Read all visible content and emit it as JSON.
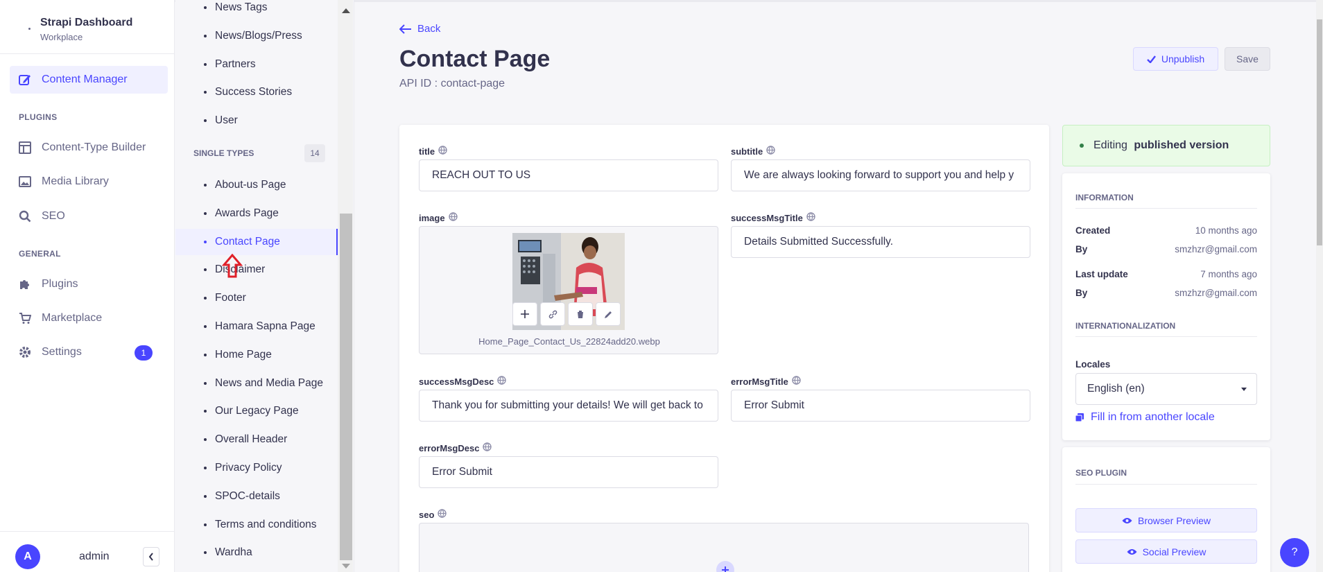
{
  "brand": {
    "title": "Strapi Dashboard",
    "subtitle": "Workplace"
  },
  "mainnav": {
    "content_manager": "Content Manager",
    "plugins_section": "PLUGINS",
    "content_type_builder": "Content-Type Builder",
    "media_library": "Media Library",
    "seo": "SEO",
    "general_section": "GENERAL",
    "plugins": "Plugins",
    "marketplace": "Marketplace",
    "settings": "Settings",
    "settings_badge": "1",
    "user_initial": "A",
    "user_name": "admin"
  },
  "subnav": {
    "collection_items": [
      "News Tags",
      "News/Blogs/Press",
      "Partners",
      "Success Stories",
      "User"
    ],
    "single_types_label": "SINGLE TYPES",
    "single_types_count": "14",
    "single_items": [
      "About-us Page",
      "Awards Page",
      "Contact Page",
      "Disclaimer",
      "Footer",
      "Hamara Sapna Page",
      "Home Page",
      "News and Media Page",
      "Our Legacy Page",
      "Overall Header",
      "Privacy Policy",
      "SPOC-details",
      "Terms and conditions",
      "Wardha"
    ]
  },
  "header": {
    "back": "Back",
    "title": "Contact Page",
    "api_id": "API ID : contact-page",
    "unpublish": "Unpublish",
    "save": "Save"
  },
  "form": {
    "title_label": "title",
    "title_value": "REACH OUT TO US",
    "subtitle_label": "subtitle",
    "subtitle_value": "We are always looking forward to support you and help y",
    "image_label": "image",
    "image_name": "Home_Page_Contact_Us_22824add20.webp",
    "success_title_label": "successMsgTitle",
    "success_title_value": "Details Submitted Successfully.",
    "success_desc_label": "successMsgDesc",
    "success_desc_value": "Thank you for submitting your details! We will get back to",
    "error_title_label": "errorMsgTitle",
    "error_title_value": "Error Submit",
    "error_desc_label": "errorMsgDesc",
    "error_desc_value": "Error Submit",
    "seo_label": "seo"
  },
  "sidebar": {
    "status_prefix": "Editing ",
    "status_strong": "published version",
    "information": "INFORMATION",
    "created_label": "Created",
    "created_value": "10 months ago",
    "by_label": "By",
    "created_by": "smzhzr@gmail.com",
    "last_update_label": "Last update",
    "last_update_value": "7 months ago",
    "updated_by": "smzhzr@gmail.com",
    "i18n": "INTERNATIONALIZATION",
    "locales_label": "Locales",
    "locale_value": "English (en)",
    "fill_locale": "Fill in from another locale",
    "seo_plugin": "SEO PLUGIN",
    "browser_preview": "Browser Preview",
    "social_preview": "Social Preview"
  },
  "help": "?",
  "colors": {
    "primary": "#4945ff",
    "success_bg": "#eafbe7",
    "text": "#32324d",
    "muted": "#666687"
  }
}
